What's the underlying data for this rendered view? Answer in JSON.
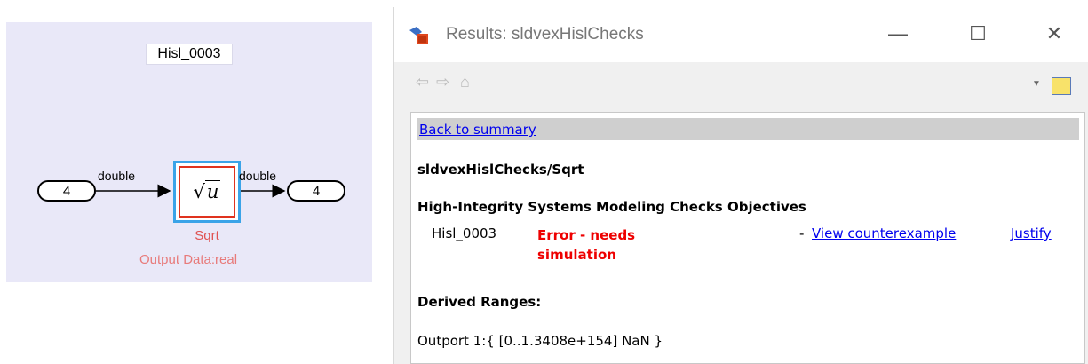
{
  "diagram": {
    "area_title": "Hisl_0003",
    "inport": {
      "label": "4"
    },
    "outport": {
      "label": "4"
    },
    "signal_in_type": "double",
    "signal_out_type": "double",
    "block": {
      "symbol": "u",
      "name": "Sqrt",
      "description": "Output Data:real"
    },
    "colors": {
      "canvas": "#e9e8f8",
      "selection": "#3aa3e8",
      "block_border": "#e0321e",
      "block_label": "#e05252"
    }
  },
  "results_window": {
    "title": "Results: sldvexHislChecks",
    "window_buttons": {
      "minimize": "—",
      "maximize": "☐",
      "close": "✕"
    },
    "toolbar": {
      "back_icon": "⇦",
      "forward_icon": "⇨",
      "home_icon": "⌂"
    },
    "content": {
      "back_link": "Back to summary",
      "system_path": "sldvexHislChecks/Sqrt",
      "section_heading": "High-Integrity Systems Modeling Checks Objectives",
      "objective": {
        "id": "Hisl_0003",
        "status": "Error - needs simulation",
        "dash": "-",
        "counterexample_link": "View counterexample",
        "justify_link": "Justify"
      },
      "ranges_heading": "Derived Ranges:",
      "range_value": "Outport 1:{ [0..1.3408e+154] NaN }"
    },
    "colors": {
      "link": "#0000ee",
      "error": "#ee0000",
      "back_bar": "#cfcfcf"
    }
  }
}
